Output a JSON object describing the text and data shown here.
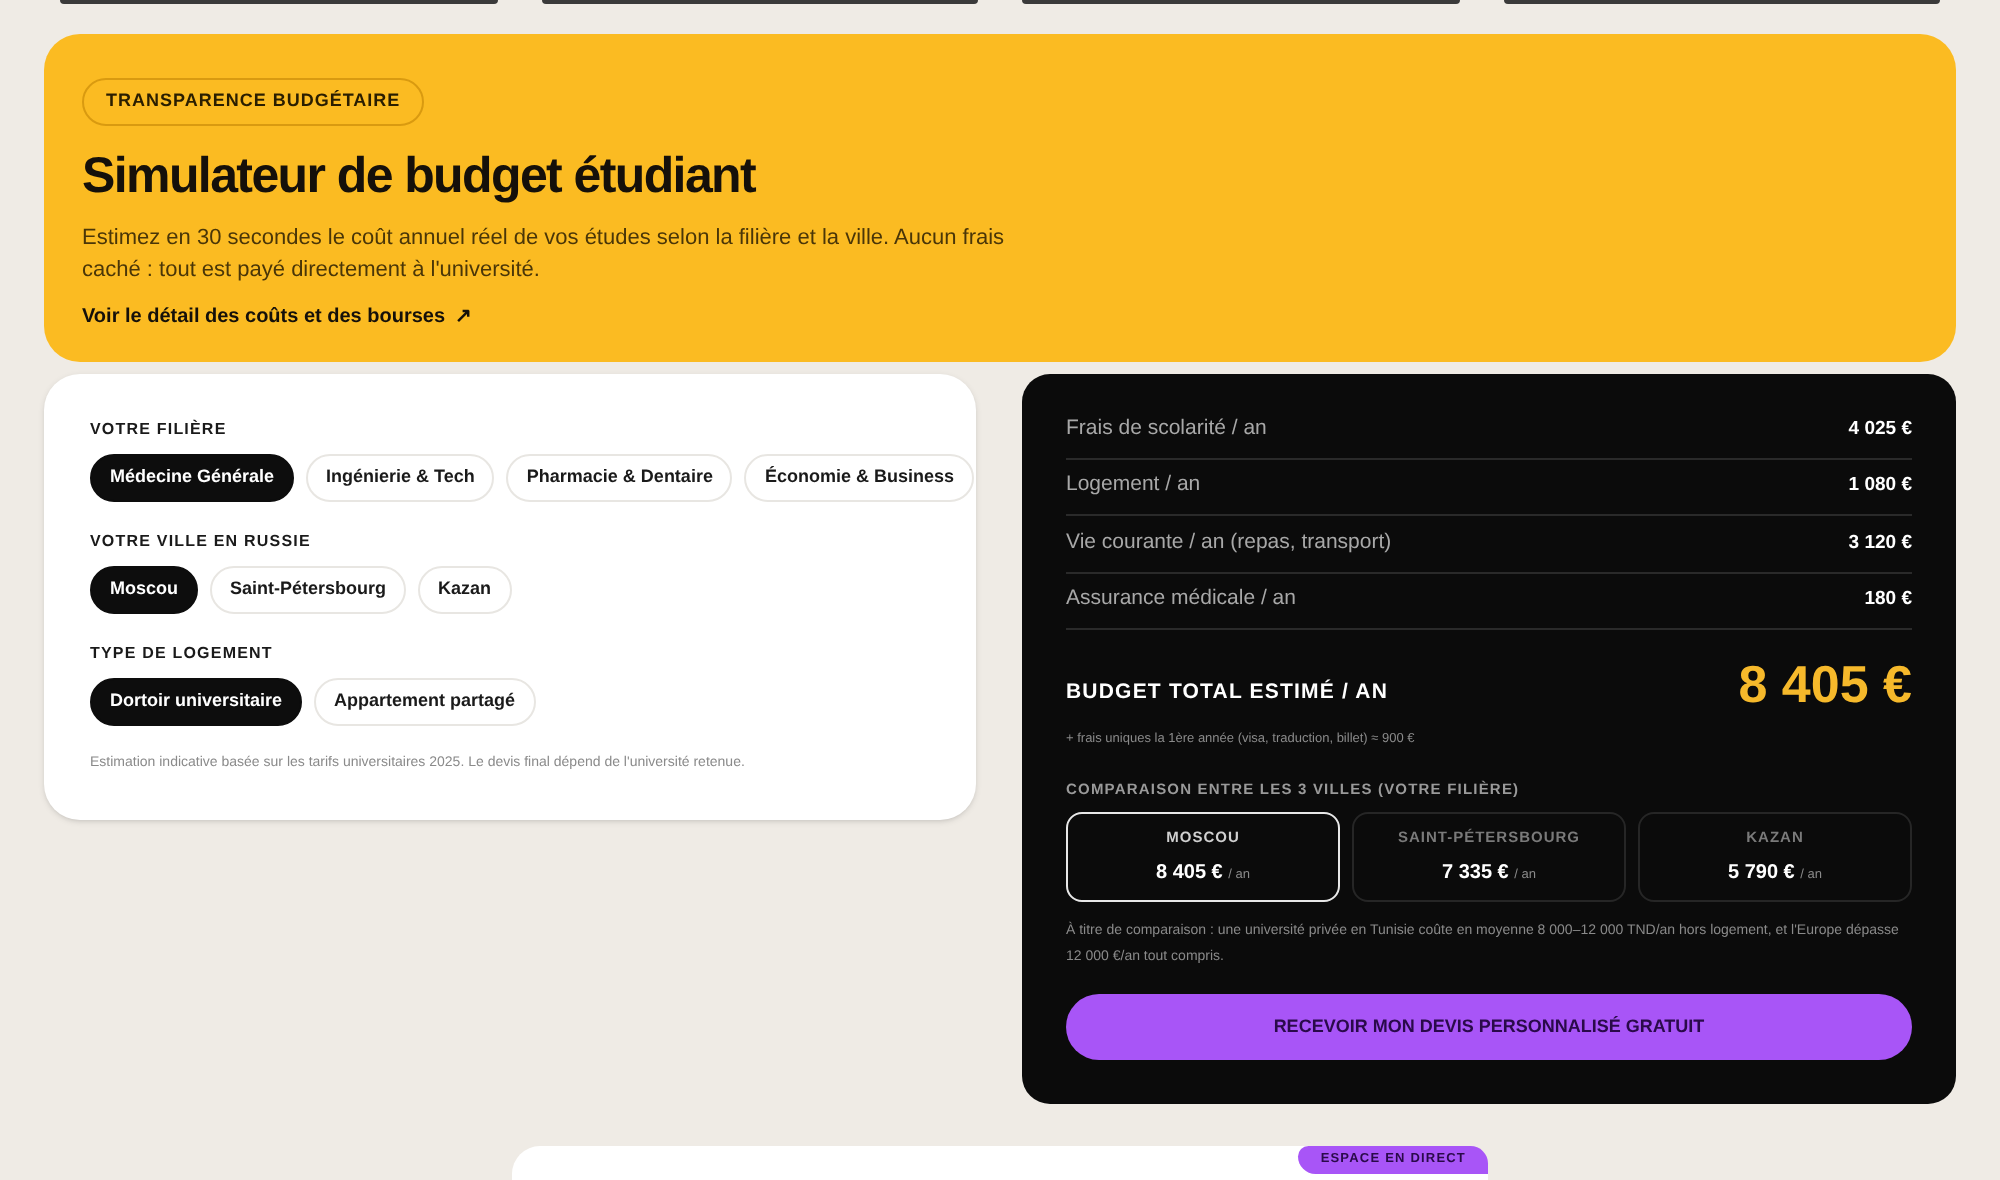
{
  "hero": {
    "badge": "TRANSPARENCE BUDGÉTAIRE",
    "title": "Simulateur de budget étudiant",
    "description": "Estimez en 30 secondes le coût annuel réel de vos études selon la filière et la ville. Aucun frais caché : tout est payé directement à l'université.",
    "link": "Voir le détail des coûts et des bourses",
    "link_icon": "↗"
  },
  "options": {
    "groups": [
      {
        "label": "VOTRE FILIÈRE",
        "choices": [
          {
            "label": "Médecine Générale",
            "selected": true
          },
          {
            "label": "Ingénierie & Tech",
            "selected": false
          },
          {
            "label": "Pharmacie & Dentaire",
            "selected": false
          },
          {
            "label": "Économie & Business",
            "selected": false
          }
        ]
      },
      {
        "label": "VOTRE VILLE EN RUSSIE",
        "choices": [
          {
            "label": "Moscou",
            "selected": true
          },
          {
            "label": "Saint-Pétersbourg",
            "selected": false
          },
          {
            "label": "Kazan",
            "selected": false
          }
        ]
      },
      {
        "label": "TYPE DE LOGEMENT",
        "choices": [
          {
            "label": "Dortoir universitaire",
            "selected": true
          },
          {
            "label": "Appartement partagé",
            "selected": false
          }
        ]
      }
    ],
    "note": "Estimation indicative basée sur les tarifs universitaires 2025. Le devis final dépend de l'université retenue."
  },
  "budget": {
    "lines": [
      {
        "label": "Frais de scolarité / an",
        "value": "4 025 €"
      },
      {
        "label": "Logement / an",
        "value": "1 080 €"
      },
      {
        "label": "Vie courante / an (repas, transport)",
        "value": "3 120 €"
      },
      {
        "label": "Assurance médicale / an",
        "value": "180 €"
      }
    ],
    "total_label": "BUDGET TOTAL ESTIMÉ / AN",
    "total_value": "8 405 €",
    "one_time_note": "+ frais uniques la 1ère année (visa, traduction, billet) ≈ 900 €",
    "comparison_title": "COMPARAISON ENTRE LES 3 VILLES (VOTRE FILIÈRE)",
    "cities": [
      {
        "name": "MOSCOU",
        "amount": "8 405 €",
        "unit": "/ an",
        "selected": true
      },
      {
        "name": "SAINT-PÉTERSBOURG",
        "amount": "7 335 €",
        "unit": "/ an",
        "selected": false
      },
      {
        "name": "KAZAN",
        "amount": "5 790 €",
        "unit": "/ an",
        "selected": false
      }
    ],
    "comparison_note": "À titre de comparaison : une université privée en Tunisie coûte en moyenne 8 000–12 000 TND/an hors logement, et l'Europe dépasse 12 000 €/an tout compris.",
    "cta": "RECEVOIR MON DEVIS PERSONNALISÉ GRATUIT"
  },
  "next_section": {
    "badge": "ESPACE EN DIRECT"
  }
}
